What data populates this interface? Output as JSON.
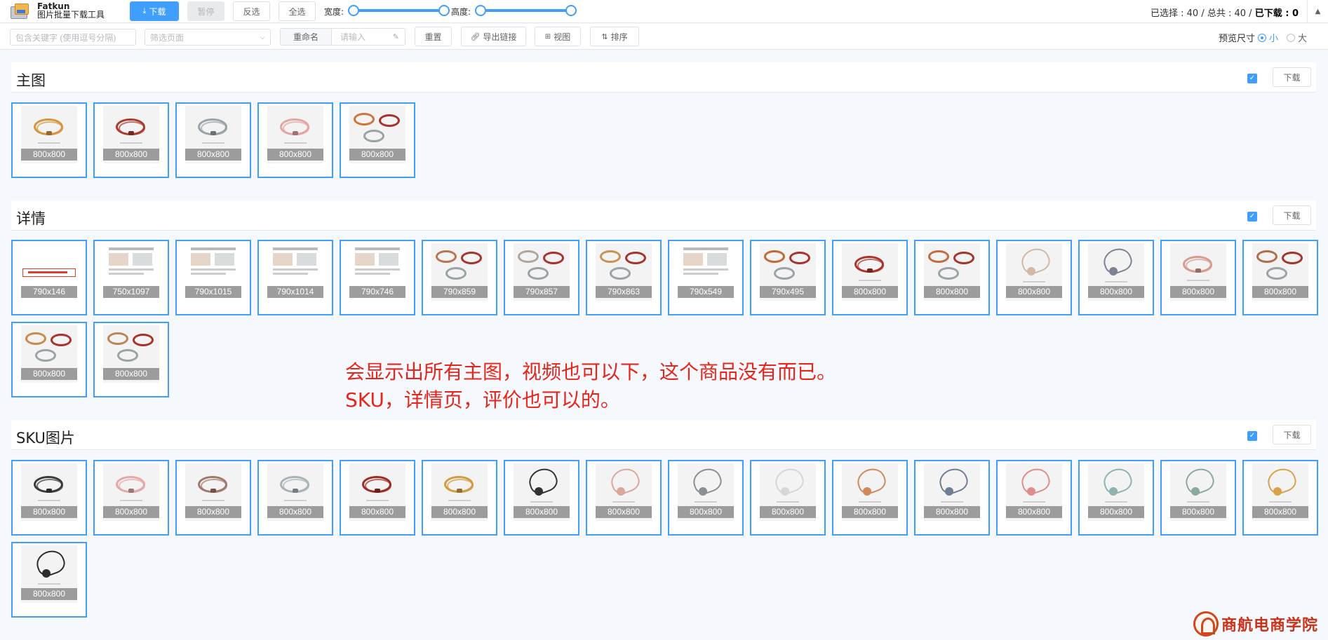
{
  "app": {
    "name": "Fatkun",
    "subtitle": "图片批量下载工具"
  },
  "toolbar": {
    "download": "下载",
    "pause": "暂停",
    "invert": "反选",
    "select_all": "全选",
    "width_label": "宽度:",
    "height_label": "高度:",
    "width_range": [
      0,
      1
    ],
    "height_range": [
      0,
      1
    ],
    "status_selected": "已选择 : 40",
    "status_total": "总共 : 40",
    "status_downloaded": "已下载 : 0",
    "separator": "/"
  },
  "filters": {
    "keyword_placeholder": "包含关键字 (使用逗号分隔)",
    "page_placeholder": "筛选页面",
    "rename_label": "重命名",
    "rename_placeholder": "请输入",
    "reset": "重置",
    "export_links": "导出链接",
    "view": "视图",
    "sort": "排序",
    "preview_size_label": "预览尺寸",
    "size_small": "小",
    "size_large": "大",
    "size_selected": "小"
  },
  "sections": {
    "main": {
      "title": "主图",
      "download": "下载",
      "images": [
        {
          "size": "800x800",
          "kind": "ring",
          "c": "#d7943f"
        },
        {
          "size": "800x800",
          "kind": "ring",
          "c": "#a93a2e"
        },
        {
          "size": "800x800",
          "kind": "ring",
          "c": "#9aa3a6"
        },
        {
          "size": "800x800",
          "kind": "ring",
          "c": "#e3a5a0"
        },
        {
          "size": "800x800",
          "kind": "rings",
          "c": "#c9773d"
        }
      ]
    },
    "detail": {
      "title": "详情",
      "download": "下载",
      "images": [
        {
          "size": "790x146",
          "kind": "banner"
        },
        {
          "size": "750x1097",
          "kind": "page"
        },
        {
          "size": "790x1015",
          "kind": "page"
        },
        {
          "size": "790x1014",
          "kind": "page"
        },
        {
          "size": "790x746",
          "kind": "page"
        },
        {
          "size": "790x859",
          "kind": "rings",
          "c": "#b87550"
        },
        {
          "size": "790x857",
          "kind": "rings",
          "c": "#b3a59a"
        },
        {
          "size": "790x863",
          "kind": "rings",
          "c": "#c99255"
        },
        {
          "size": "790x549",
          "kind": "page"
        },
        {
          "size": "790x495",
          "kind": "rings",
          "c": "#c7662f"
        },
        {
          "size": "800x800",
          "kind": "ring",
          "c": "#a9322b"
        },
        {
          "size": "800x800",
          "kind": "rings",
          "c": "#c46a3e"
        },
        {
          "size": "800x800",
          "kind": "cord",
          "c": "#d3b9a3"
        },
        {
          "size": "800x800",
          "kind": "cord",
          "c": "#7b8490"
        },
        {
          "size": "800x800",
          "kind": "ring",
          "c": "#d79a8f"
        },
        {
          "size": "800x800",
          "kind": "rings",
          "c": "#b26b4b"
        },
        {
          "size": "800x800",
          "kind": "rings",
          "c": "#c98a4a"
        },
        {
          "size": "800x800",
          "kind": "rings",
          "c": "#b8865a"
        }
      ]
    },
    "sku": {
      "title": "SKU图片",
      "download": "下载",
      "images": [
        {
          "size": "800x800",
          "kind": "ring",
          "c": "#3a3a3a"
        },
        {
          "size": "800x800",
          "kind": "ring",
          "c": "#e5a7a7"
        },
        {
          "size": "800x800",
          "kind": "ring",
          "c": "#a0786c"
        },
        {
          "size": "800x800",
          "kind": "ring",
          "c": "#a9b3b8"
        },
        {
          "size": "800x800",
          "kind": "ring",
          "c": "#9e2b24"
        },
        {
          "size": "800x800",
          "kind": "ring",
          "c": "#d39a3e"
        },
        {
          "size": "800x800",
          "kind": "cord",
          "c": "#333333"
        },
        {
          "size": "800x800",
          "kind": "cord",
          "c": "#d8a79a"
        },
        {
          "size": "800x800",
          "kind": "cord",
          "c": "#8a8f93"
        },
        {
          "size": "800x800",
          "kind": "cord",
          "c": "#d6d6d6"
        },
        {
          "size": "800x800",
          "kind": "cord",
          "c": "#d08a5a"
        },
        {
          "size": "800x800",
          "kind": "cord",
          "c": "#6f7d93"
        },
        {
          "size": "800x800",
          "kind": "cord",
          "c": "#de8d89"
        },
        {
          "size": "800x800",
          "kind": "cord",
          "c": "#8fb3b3"
        },
        {
          "size": "800x800",
          "kind": "cord",
          "c": "#8aa9a0"
        },
        {
          "size": "800x800",
          "kind": "cord",
          "c": "#d8a24a"
        },
        {
          "size": "800x800",
          "kind": "cord",
          "c": "#2c2c2c"
        }
      ]
    }
  },
  "annotation": {
    "line1": "会显示出所有主图，视频也可以下，这个商品没有而已。",
    "line2": "SKU，详情页，评价也可以的。"
  },
  "watermark": {
    "text": "商航电商学院"
  },
  "colors": {
    "accent": "#409eff",
    "annotation": "#e8251b"
  }
}
